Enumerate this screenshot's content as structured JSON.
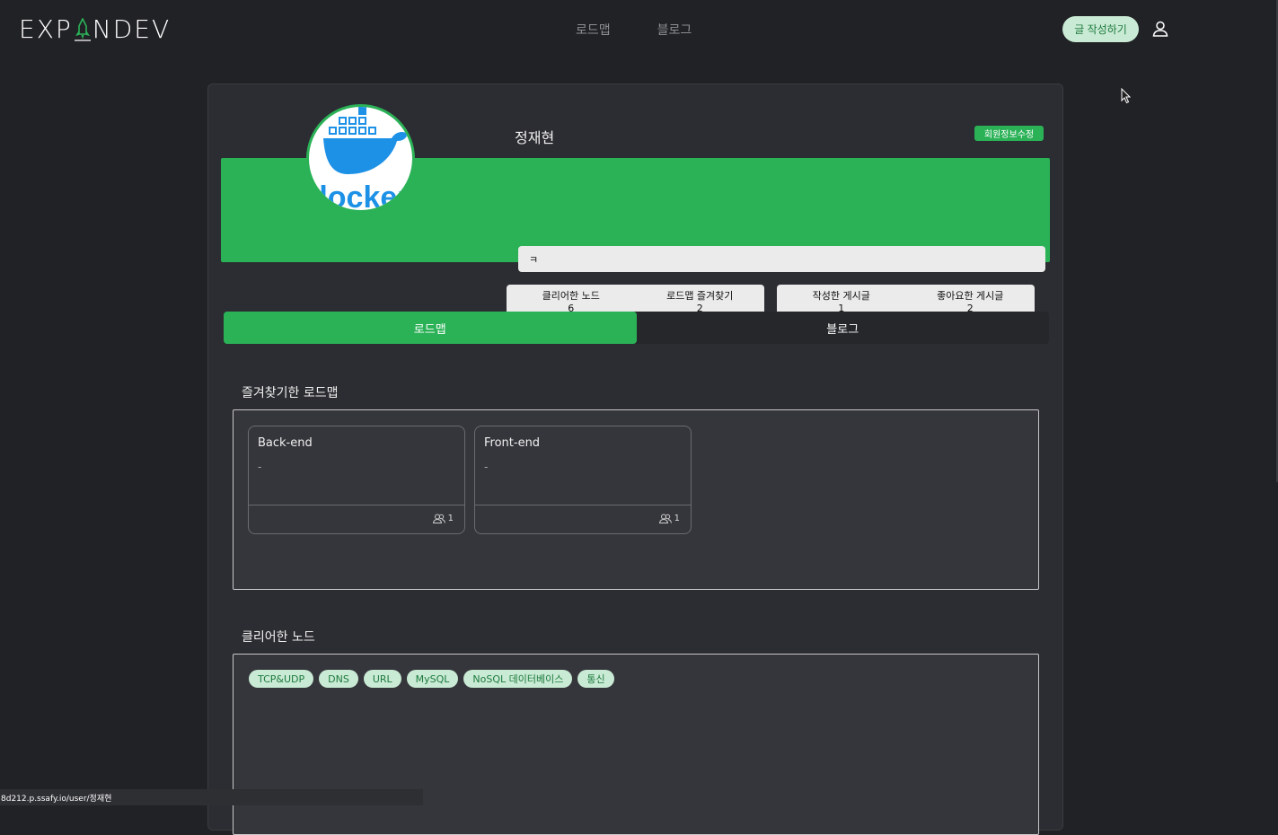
{
  "header": {
    "logo_text_left": "EXP",
    "logo_text_right": "NDEV",
    "nav": [
      "로드맵",
      "블로그"
    ],
    "write_button": "글 작성하기",
    "user_icon": "user-icon"
  },
  "profile": {
    "username": "정재현",
    "edit_button": "회원정보수정",
    "bio": "ㅋ",
    "avatar_image": "docker-logo",
    "stats": [
      {
        "label": "클리어한 노드",
        "value": "6"
      },
      {
        "label": "로드맵 즐겨찾기",
        "value": "2"
      },
      {
        "label": "작성한 게시글",
        "value": "1"
      },
      {
        "label": "좋아요한 게시글",
        "value": "2"
      }
    ]
  },
  "tabs": [
    {
      "label": "로드맵",
      "active": true
    },
    {
      "label": "블로그",
      "active": false
    }
  ],
  "favorites": {
    "title": "즐겨찾기한 로드맵",
    "items": [
      {
        "name": "Back-end",
        "desc": "-",
        "count": "1"
      },
      {
        "name": "Front-end",
        "desc": "-",
        "count": "1"
      }
    ]
  },
  "cleared": {
    "title": "클리어한 노드",
    "nodes": [
      "TCP&UDP",
      "DNS",
      "URL",
      "MySQL",
      "NoSQL 데이터베이스",
      "통신"
    ]
  },
  "status_bar": "8d212.p.ssafy.io/user/정재현",
  "colors": {
    "accent": "#2bb257",
    "background": "#212226",
    "card": "#2c2d32",
    "chip": "#c9ead4"
  }
}
